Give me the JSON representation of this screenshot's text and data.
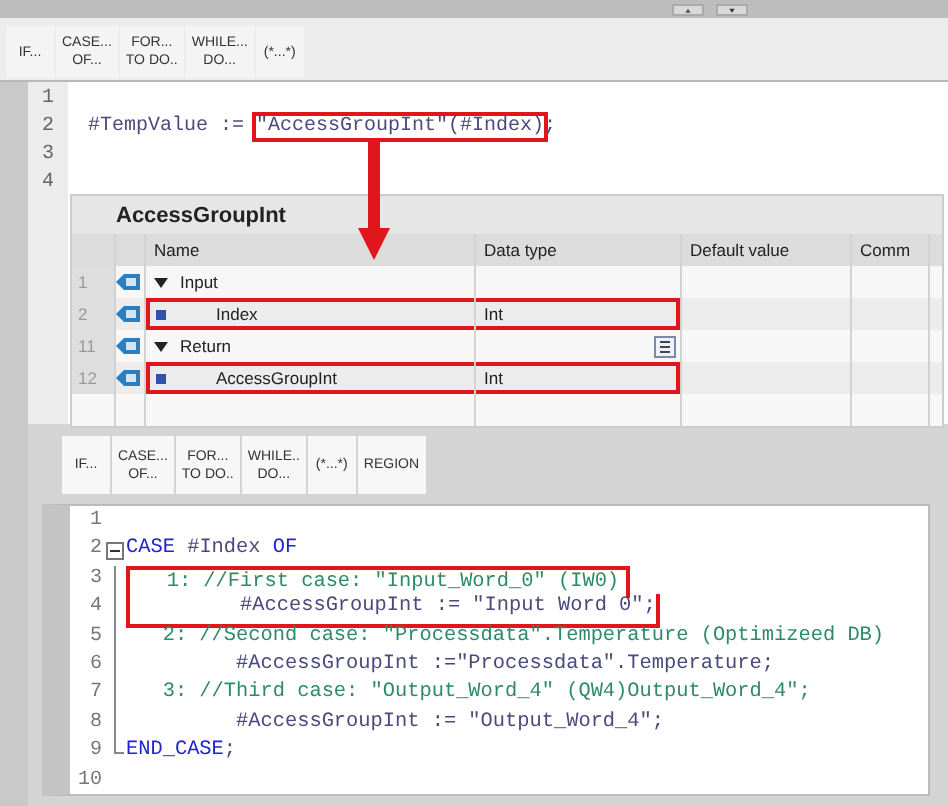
{
  "toolbar_top": [
    {
      "label": "IF..."
    },
    {
      "label": "CASE...\nOF..."
    },
    {
      "label": "FOR...\nTO DO.."
    },
    {
      "label": "WHILE...\nDO..."
    },
    {
      "label": "(*...*)"
    }
  ],
  "editor_top": {
    "lines": [
      {
        "number": "1"
      },
      {
        "number": "2",
        "segments": [
          {
            "kind": "var",
            "text": "#TempValue := "
          },
          {
            "kind": "var",
            "text": "\"AccessGroupInt\"(#Index)",
            "highlighted": true
          },
          {
            "kind": "var",
            "text": ";"
          }
        ]
      },
      {
        "number": "3"
      },
      {
        "number": "4"
      }
    ]
  },
  "interface_panel": {
    "title": "AccessGroupInt",
    "columns": [
      "Name",
      "Data type",
      "Default value",
      "Comm"
    ],
    "rows": [
      {
        "number": "1",
        "kind": "section",
        "expanded": true,
        "name": "Input",
        "highlighted": false
      },
      {
        "number": "2",
        "kind": "param",
        "name": "Index",
        "data_type": "Int",
        "highlighted": true
      },
      {
        "number": "11",
        "kind": "section",
        "expanded": true,
        "name": "Return",
        "highlighted": false
      },
      {
        "number": "12",
        "kind": "param",
        "name": "AccessGroupInt",
        "data_type": "Int",
        "highlighted": true
      }
    ]
  },
  "toolbar_bottom": [
    {
      "label": "IF..."
    },
    {
      "label": "CASE...\nOF..."
    },
    {
      "label": "FOR...\nTO DO.."
    },
    {
      "label": "WHILE..\nDO..."
    },
    {
      "label": "(*...*)"
    },
    {
      "label": "REGION"
    }
  ],
  "editor_bottom": {
    "lines": [
      {
        "number": "1",
        "kind": "plain"
      },
      {
        "number": "2",
        "kind": "fold_start",
        "segments": [
          {
            "kind": "keyword",
            "text": "CASE"
          },
          {
            "kind": "var",
            "text": " #Index "
          },
          {
            "kind": "keyword",
            "text": "OF"
          }
        ]
      },
      {
        "number": "3",
        "kind": "fold_inside",
        "highlighted": true,
        "segments": [
          {
            "kind": "comment",
            "text": "   1: //First case: \"Input_Word_0\" (IW0)"
          }
        ]
      },
      {
        "number": "4",
        "kind": "fold_inside",
        "highlighted": true,
        "segments": [
          {
            "kind": "var",
            "text": "         #AccessGroupInt := \"Input Word 0\";"
          }
        ]
      },
      {
        "number": "5",
        "kind": "fold_inside",
        "segments": [
          {
            "kind": "comment",
            "text": "   2: //Second case: \"Processdata\".Temperature (Optimizeed DB)"
          }
        ]
      },
      {
        "number": "6",
        "kind": "fold_inside",
        "segments": [
          {
            "kind": "var",
            "text": "         #AccessGroupInt :=\"Processdata\".Temperature;"
          }
        ]
      },
      {
        "number": "7",
        "kind": "fold_inside",
        "segments": [
          {
            "kind": "comment",
            "text": "   3: //Third case: \"Output_Word_4\" (QW4)Output_Word_4\";"
          }
        ]
      },
      {
        "number": "8",
        "kind": "fold_inside",
        "segments": [
          {
            "kind": "var",
            "text": "         #AccessGroupInt := \"Output_Word_4\";"
          }
        ]
      },
      {
        "number": "9",
        "kind": "fold_end",
        "segments": [
          {
            "kind": "keyword",
            "text": "END_CASE"
          },
          {
            "kind": "var",
            "text": ";"
          }
        ]
      },
      {
        "number": "10",
        "kind": "plain"
      }
    ]
  }
}
